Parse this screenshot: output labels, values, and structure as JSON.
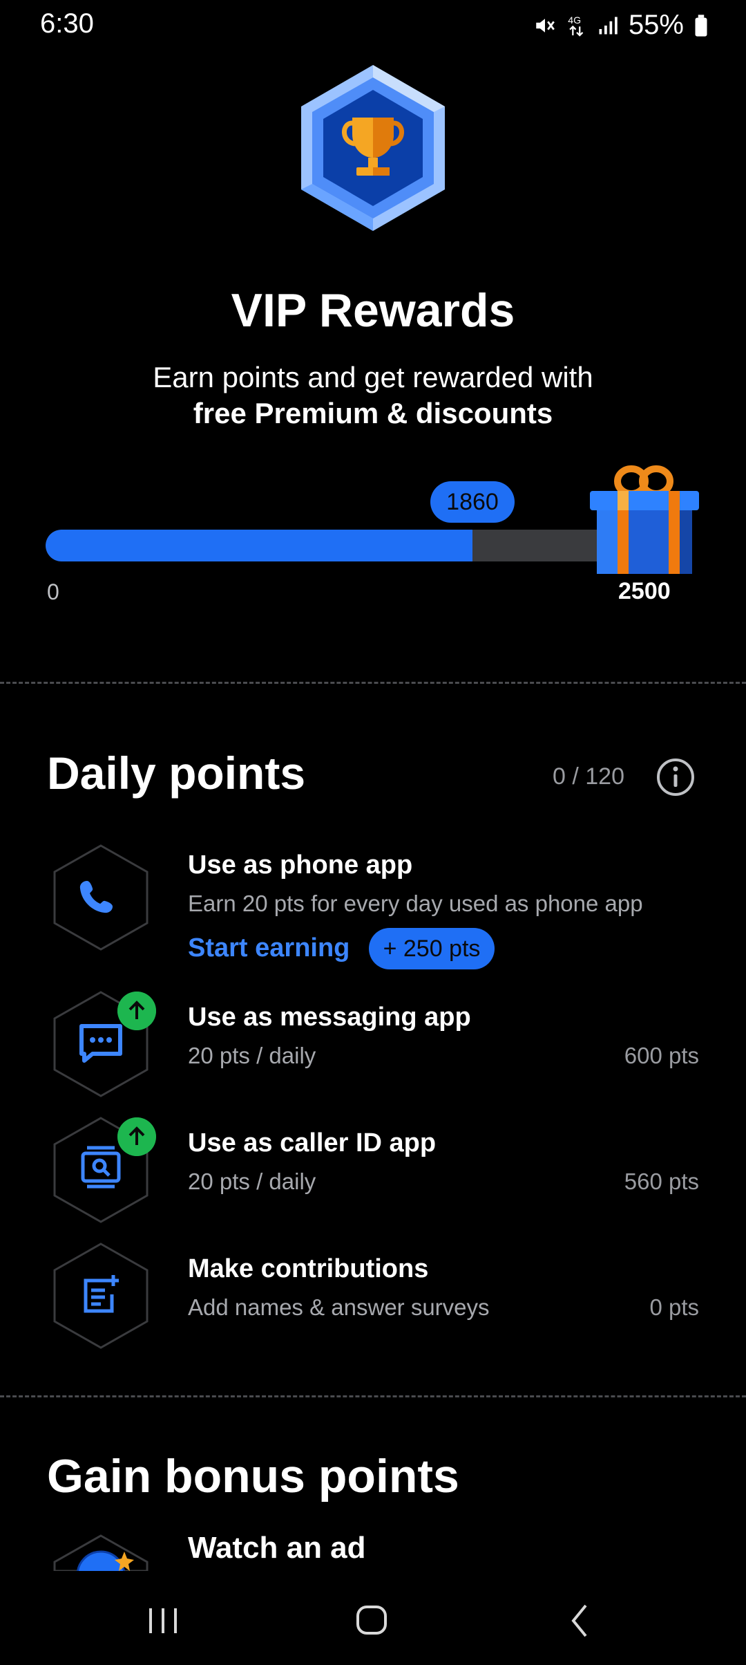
{
  "status_bar": {
    "time": "6:30",
    "battery": "55%",
    "network": "4G"
  },
  "hero": {
    "title": "VIP Rewards",
    "subtitle_line1": "Earn points and get rewarded with",
    "subtitle_line2": "free Premium & discounts",
    "icon": "trophy-hexagon-icon"
  },
  "progress": {
    "current": 1860,
    "current_label": "1860",
    "min_label": "0",
    "max_label": "2500",
    "max": 2500
  },
  "daily": {
    "title": "Daily points",
    "count": "0 / 120",
    "items": [
      {
        "title": "Use as phone app",
        "subtitle": "Earn 20 pts for every day used as phone app",
        "points": "",
        "icon": "phone-icon",
        "badge": false,
        "action_label": "Start earning",
        "bonus_label": "+ 250 pts"
      },
      {
        "title": "Use as messaging app",
        "subtitle": "20 pts / daily",
        "points": "600 pts",
        "icon": "message-icon",
        "badge": true
      },
      {
        "title": "Use as caller ID app",
        "subtitle": "20 pts / daily",
        "points": "560 pts",
        "icon": "caller-id-icon",
        "badge": true
      },
      {
        "title": "Make contributions",
        "subtitle": "Add names & answer surveys",
        "points": "0 pts",
        "icon": "note-add-icon",
        "badge": false
      }
    ]
  },
  "bonus": {
    "title": "Gain bonus points",
    "first_item": "Watch an ad"
  },
  "colors": {
    "accent": "#1f6ff5",
    "link": "#3d86ff",
    "green": "#1db64f"
  }
}
